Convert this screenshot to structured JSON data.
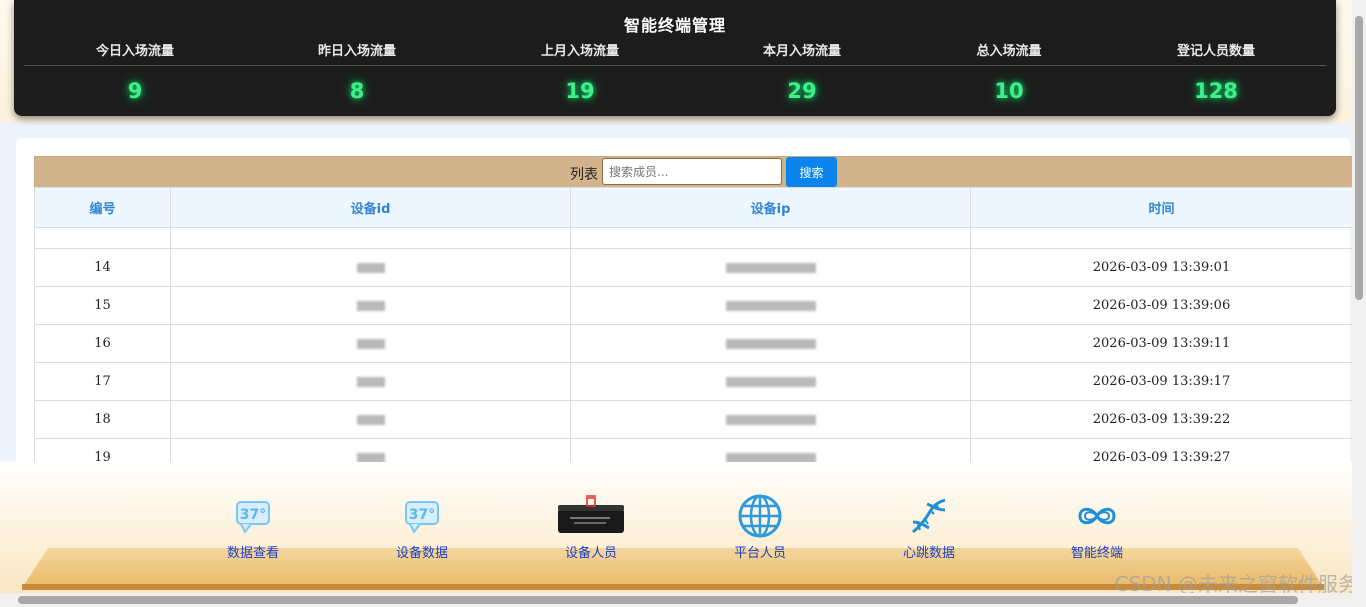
{
  "header": {
    "title": "智能终端管理",
    "stats": [
      {
        "label": "今日入场流量",
        "value": "9"
      },
      {
        "label": "昨日入场流量",
        "value": "8"
      },
      {
        "label": "上月入场流量",
        "value": "19"
      },
      {
        "label": "本月入场流量",
        "value": "29"
      },
      {
        "label": "总入场流量",
        "value": "10"
      },
      {
        "label": "登记人员数量",
        "value": "128"
      }
    ]
  },
  "list": {
    "label": "列表",
    "search_placeholder": "搜索成员...",
    "search_button": "搜索",
    "columns": [
      "编号",
      "设备id",
      "设备ip",
      "时间"
    ],
    "rows": [
      {
        "id": "14",
        "time": "2026-03-09 13:39:01"
      },
      {
        "id": "15",
        "time": "2026-03-09 13:39:06"
      },
      {
        "id": "16",
        "time": "2026-03-09 13:39:11"
      },
      {
        "id": "17",
        "time": "2026-03-09 13:39:17"
      },
      {
        "id": "18",
        "time": "2026-03-09 13:39:22"
      },
      {
        "id": "19",
        "time": "2026-03-09 13:39:27"
      }
    ]
  },
  "nav": {
    "items": [
      {
        "label": "数据查看",
        "icon": "thermometer-icon"
      },
      {
        "label": "设备数据",
        "icon": "thermometer-icon"
      },
      {
        "label": "设备人员",
        "icon": "device-box-icon"
      },
      {
        "label": "平台人员",
        "icon": "globe-icon"
      },
      {
        "label": "心跳数据",
        "icon": "dna-icon"
      },
      {
        "label": "智能终端",
        "icon": "infinity-icon"
      }
    ]
  },
  "watermark": "CSDN @未来之窗软件服务",
  "colors": {
    "accent_green": "#3ef08a",
    "header_bg": "#1c1c1c",
    "toolbar_bg": "#d2b48c",
    "button_blue": "#0b84ee",
    "nav_text": "#1a3ec8"
  }
}
